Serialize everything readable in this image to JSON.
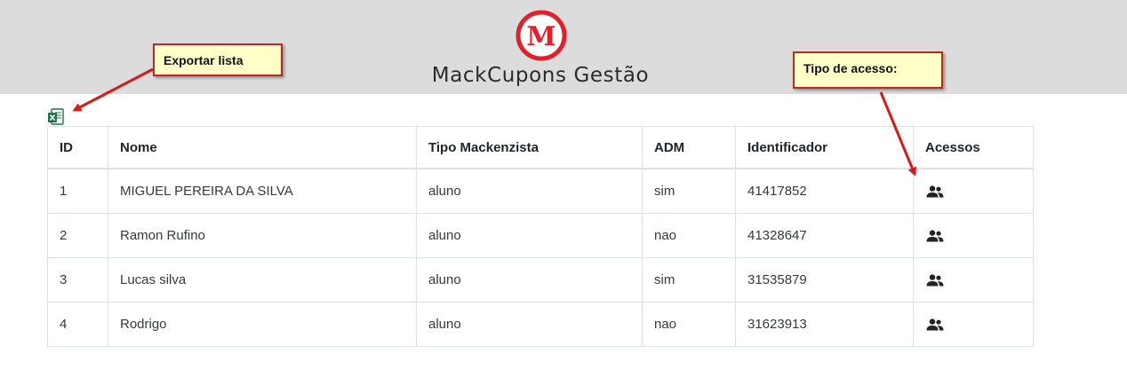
{
  "header": {
    "logo_letter": "M",
    "brand": "MackCupons Gestão"
  },
  "export_icon": "excel-export-icon",
  "table": {
    "columns": [
      "ID",
      "Nome",
      "Tipo Mackenzista",
      "ADM",
      "Identificador",
      "Acessos"
    ],
    "rows": [
      {
        "id": "1",
        "nome": "MIGUEL PEREIRA DA SILVA",
        "tipo": "aluno",
        "adm": "sim",
        "identificador": "41417852",
        "acessos_icon": "users-icon"
      },
      {
        "id": "2",
        "nome": "Ramon Rufino",
        "tipo": "aluno",
        "adm": "nao",
        "identificador": "41328647",
        "acessos_icon": "users-icon"
      },
      {
        "id": "3",
        "nome": "Lucas silva",
        "tipo": "aluno",
        "adm": "sim",
        "identificador": "31535879",
        "acessos_icon": "users-icon"
      },
      {
        "id": "4",
        "nome": "Rodrigo",
        "tipo": "aluno",
        "adm": "nao",
        "identificador": "31623913",
        "acessos_icon": "users-icon"
      }
    ]
  },
  "annotations": {
    "export": "Exportar lista",
    "tipo_acesso": "Tipo de acesso:"
  },
  "colors": {
    "header_bg": "#dcdcdc",
    "logo_red": "#e3202a",
    "callout_bg": "#ffffc8",
    "callout_border": "#c0281e",
    "excel_green": "#1f7244"
  }
}
